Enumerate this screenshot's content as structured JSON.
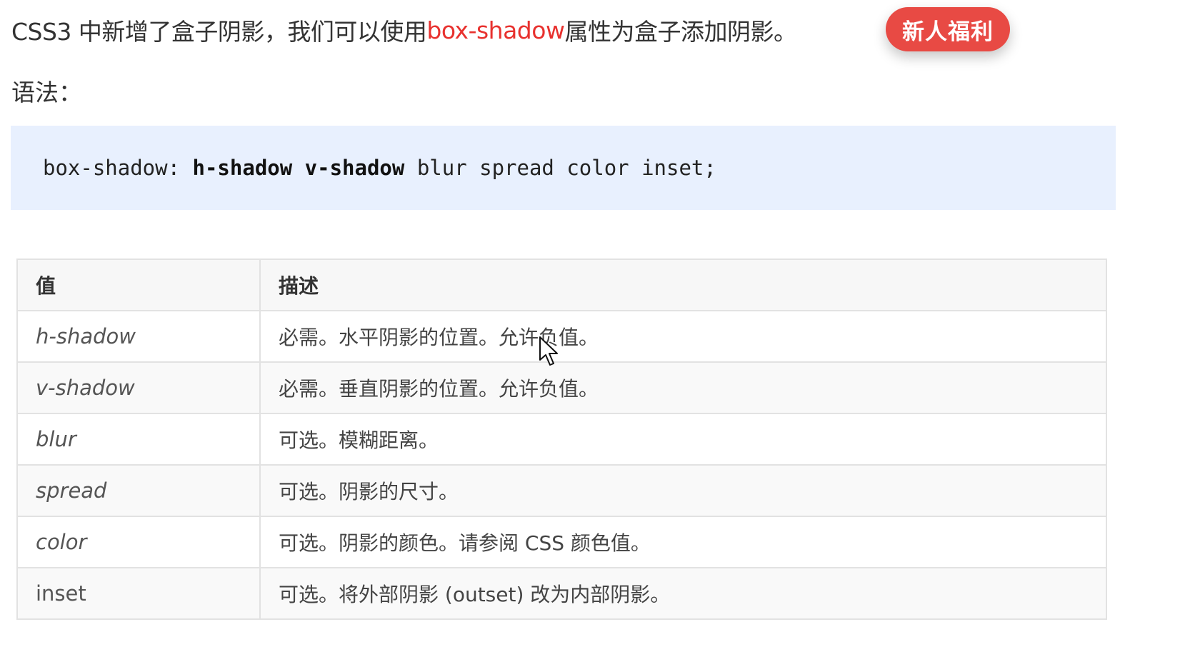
{
  "intro": {
    "before": "CSS3 中新增了盒子阴影，我们可以使用",
    "highlight": "box-shadow",
    "after": "属性为盒子添加阴影。"
  },
  "badge": {
    "label": "新人福利",
    "color": "#e84a44"
  },
  "syntax_label": "语法：",
  "code": {
    "prefix": "box-shadow: ",
    "bold1": "h-shadow",
    "space": " ",
    "bold2": "v-shadow",
    "suffix": " blur spread color inset;"
  },
  "table": {
    "headers": [
      "值",
      "描述"
    ],
    "rows": [
      {
        "value": "h-shadow",
        "description": "必需。水平阴影的位置。允许负值。"
      },
      {
        "value": "v-shadow",
        "description": "必需。垂直阴影的位置。允许负值。"
      },
      {
        "value": "blur",
        "description": "可选。模糊距离。"
      },
      {
        "value": "spread",
        "description": "可选。阴影的尺寸。"
      },
      {
        "value": "color",
        "description": "可选。阴影的颜色。请参阅 CSS 颜色值。"
      },
      {
        "value": "inset",
        "description": "可选。将外部阴影 (outset) 改为内部阴影。"
      }
    ]
  },
  "colors": {
    "highlight": "#e8312e",
    "code_background": "#e8f0fe"
  }
}
